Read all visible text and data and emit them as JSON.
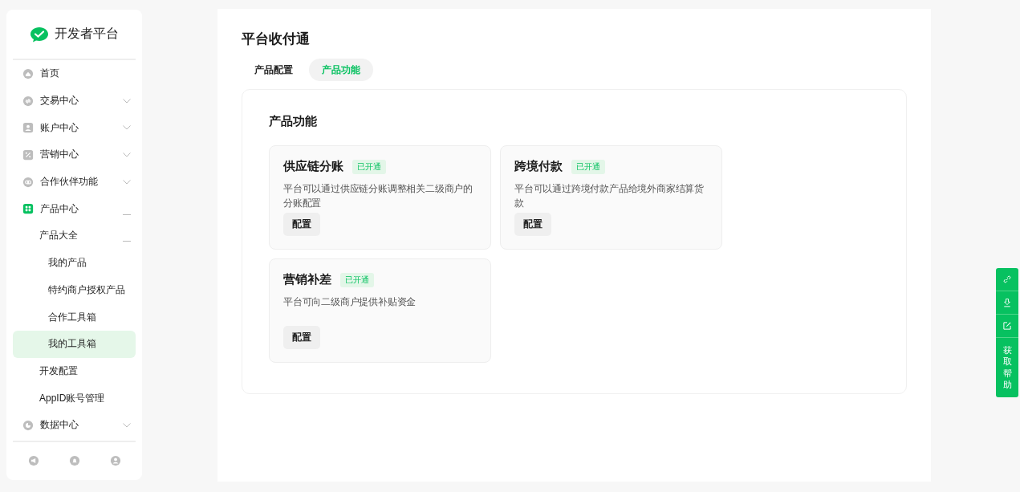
{
  "sidebar": {
    "logo_text": "开发者平台",
    "items": [
      {
        "label": "首页",
        "selected": false
      },
      {
        "label": "交易中心",
        "expanded": false,
        "selected": false
      },
      {
        "label": "账户中心",
        "expanded": false,
        "selected": false
      },
      {
        "label": "营销中心",
        "expanded": false,
        "selected": false
      },
      {
        "label": "合作伙伴功能",
        "expanded": false,
        "selected": false
      },
      {
        "label": "产品中心",
        "expanded": true,
        "selected": false,
        "children": [
          {
            "label": "产品大全",
            "expanded": true,
            "selected": false,
            "children": [
              {
                "label": "我的产品",
                "selected": false
              },
              {
                "label": "特约商户授权产品",
                "selected": false
              },
              {
                "label": "合作工具箱",
                "selected": false
              },
              {
                "label": "我的工具箱",
                "selected": true
              }
            ]
          },
          {
            "label": "开发配置",
            "selected": false
          },
          {
            "label": "AppID账号管理",
            "selected": false
          }
        ]
      },
      {
        "label": "数据中心",
        "expanded": false,
        "selected": false
      }
    ]
  },
  "page": {
    "title": "平台收付通",
    "tabs": [
      {
        "label": "产品配置",
        "selected": false
      },
      {
        "label": "产品功能",
        "selected": true
      }
    ],
    "section_title": "产品功能",
    "products": [
      {
        "name": "供应链分账",
        "status": "已开通",
        "description": "平台可以通过供应链分账调整相关二级商户的分账配置",
        "button": "配置"
      },
      {
        "name": "跨境付款",
        "status": "已开通",
        "description": "平台可以通过跨境付款产品给境外商家结算货款",
        "button": "配置"
      },
      {
        "name": "营销补差",
        "status": "已开通",
        "description": "平台可向二级商户提供补贴资金",
        "button": "配置"
      }
    ]
  },
  "help_toolbar": {
    "label": "获取帮助"
  }
}
